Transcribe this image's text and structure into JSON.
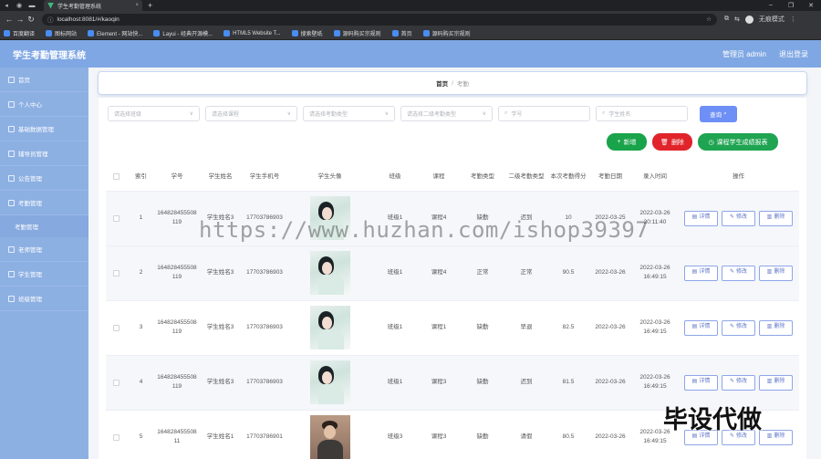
{
  "browser": {
    "tab_title": "学生考勤管理系统",
    "url": "localhost:8081/#/kaoqin",
    "profile_label": "无痕模式",
    "bookmarks": [
      "百度翻译",
      "图标网站",
      "Element - 网站快...",
      "Layui - 经典开源模...",
      "HTML5 Website T...",
      "搜索壁纸",
      "源码购买宗规则",
      "首页",
      "源码购买宗规则"
    ]
  },
  "header": {
    "title": "学生考勤管理系统",
    "admin_label": "管理员 admin",
    "logout_label": "退出登录"
  },
  "sidebar": {
    "items": [
      {
        "label": "首页"
      },
      {
        "label": "个人中心"
      },
      {
        "label": "基础数据管理"
      },
      {
        "label": "辅导员管理"
      },
      {
        "label": "公告管理"
      },
      {
        "label": "考勤管理"
      },
      {
        "label": "考勤管理"
      },
      {
        "label": "老师管理"
      },
      {
        "label": "学生管理"
      },
      {
        "label": "班级管理"
      }
    ]
  },
  "breadcrumb": {
    "home": "首页",
    "separator": "/",
    "current": "考勤"
  },
  "filters": {
    "class_placeholder": "请选择班级",
    "course_placeholder": "请选择课程",
    "type_placeholder": "请选择考勤类型",
    "subtype_placeholder": "请选择二级考勤类型",
    "student_no_placeholder": "学号",
    "student_name_placeholder": "学生姓名",
    "search_label": "查询"
  },
  "actions": {
    "add": "新增",
    "delete": "删除",
    "report": "课程学生成绩报表"
  },
  "table": {
    "headers": [
      "索引",
      "学号",
      "学生姓名",
      "学生手机号",
      "学生头像",
      "班级",
      "课程",
      "考勤类型",
      "二级考勤类型",
      "本次考勤得分",
      "考勤日期",
      "录入时间",
      "操作"
    ],
    "op_labels": {
      "detail": "详情",
      "edit": "修改",
      "delete": "删除"
    },
    "rows": [
      {
        "index": "1",
        "student_no": "164828455508119",
        "name": "学生姓名3",
        "phone": "17703786903",
        "avatar": "woman",
        "class": "班级1",
        "course": "课程4",
        "type": "缺勤",
        "subtype": "迟到",
        "score": "10",
        "date": "2022-03-25",
        "created": "2022-03-26 20:11:40"
      },
      {
        "index": "2",
        "student_no": "164828455508119",
        "name": "学生姓名3",
        "phone": "17703786903",
        "avatar": "woman",
        "class": "班级1",
        "course": "课程4",
        "type": "正常",
        "subtype": "正常",
        "score": "90.5",
        "date": "2022-03-26",
        "created": "2022-03-26 16:49:15"
      },
      {
        "index": "3",
        "student_no": "164828455508119",
        "name": "学生姓名3",
        "phone": "17703786903",
        "avatar": "woman",
        "class": "班级1",
        "course": "课程1",
        "type": "缺勤",
        "subtype": "早退",
        "score": "82.5",
        "date": "2022-03-26",
        "created": "2022-03-26 16:49:15"
      },
      {
        "index": "4",
        "student_no": "164828455508119",
        "name": "学生姓名3",
        "phone": "17703786903",
        "avatar": "woman",
        "class": "班级1",
        "course": "课程3",
        "type": "缺勤",
        "subtype": "迟到",
        "score": "81.5",
        "date": "2022-03-26",
        "created": "2022-03-26 16:49:15"
      },
      {
        "index": "5",
        "student_no": "16482845550811",
        "name": "学生姓名1",
        "phone": "17703786901",
        "avatar": "man",
        "class": "班级3",
        "course": "课程3",
        "type": "缺勤",
        "subtype": "请假",
        "score": "80.5",
        "date": "2022-03-26",
        "created": "2022-03-26 16:49:15"
      }
    ]
  },
  "watermarks": {
    "url": "https://www.huzhan.com/ishop39397",
    "cn": "毕设代做"
  }
}
